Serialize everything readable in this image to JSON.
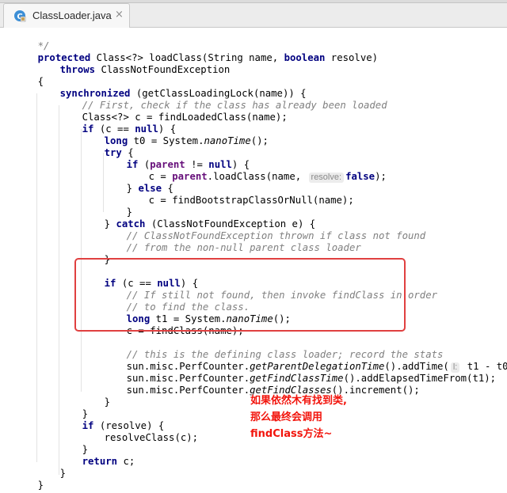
{
  "tab": {
    "file_name": "ClassLoader.java",
    "close_symbol": "×",
    "icon": "java-class-icon"
  },
  "code": {
    "line_01": "*/",
    "line_02": {
      "k1": "protected",
      "t1": " Class<?> loadClass(String name, ",
      "k2": "boolean",
      "t2": " resolve)"
    },
    "line_03": {
      "k1": "throws",
      "t1": " ClassNotFoundException"
    },
    "line_04": "{",
    "line_05": {
      "k1": "synchronized",
      "t1": " (getClassLoadingLock(name)) {"
    },
    "line_06": "// First, check if the class has already been loaded",
    "line_07": "Class<?> c = findLoadedClass(name);",
    "line_08": {
      "k1": "if",
      "t1": " (c == ",
      "k2": "null",
      "t2": ") {"
    },
    "line_09": {
      "k1": "long",
      "t1": " t0 = System.",
      "i1": "nanoTime",
      "t2": "();"
    },
    "line_10": {
      "k1": "try",
      "t1": " {"
    },
    "line_11": {
      "k1": "if",
      "t1": " (",
      "f1": "parent",
      "t2": " != ",
      "k2": "null",
      "t3": ") {"
    },
    "line_12": {
      "t1": "c = ",
      "f1": "parent",
      "t2": ".loadClass(name, ",
      "hint": "resolve:",
      "k1": "false",
      "t3": ");"
    },
    "line_13": {
      "t1": "} ",
      "k1": "else",
      "t2": " {"
    },
    "line_14": "c = findBootstrapClassOrNull(name);",
    "line_15": "}",
    "line_16": {
      "t1": "} ",
      "k1": "catch",
      "t2": " (ClassNotFoundException e) {"
    },
    "line_17": "// ClassNotFoundException thrown if class not found",
    "line_18": "// from the non-null parent class loader",
    "line_19": "}",
    "line_20": {
      "k1": "if",
      "t1": " (c == ",
      "k2": "null",
      "t2": ") {"
    },
    "line_21": "// If still not found, then invoke findClass in order",
    "line_22": "// to find the class.",
    "line_23": {
      "k1": "long",
      "t1": " t1 = System.",
      "i1": "nanoTime",
      "t2": "();"
    },
    "line_24": "c = findClass(name);",
    "line_25": "// this is the defining class loader; record the stats",
    "line_26": {
      "t1": "sun.misc.PerfCounter.",
      "i1": "getParentDelegationTime",
      "t2": "().addTime(",
      "hint": "l:",
      "t3": " t1 - t0);"
    },
    "line_27": {
      "t1": "sun.misc.PerfCounter.",
      "i1": "getFindClassTime",
      "t2": "().addElapsedTimeFrom(t1);"
    },
    "line_28": {
      "t1": "sun.misc.PerfCounter.",
      "i1": "getFindClasses",
      "t2": "().increment();"
    },
    "line_29": "}",
    "line_30": "}",
    "line_31": {
      "k1": "if",
      "t1": " (resolve) {"
    },
    "line_32": "resolveClass(c);",
    "line_33": "}",
    "line_34": {
      "k1": "return",
      "t1": " c;"
    },
    "line_35": "}",
    "line_36": "}"
  },
  "annotation": {
    "line1": "如果依然木有找到类,",
    "line2": "那么最终会调用",
    "line3": "findClass方法~",
    "color": "#f2140c"
  },
  "colors": {
    "keyword": "#000080",
    "comment": "#808080",
    "field": "#660e7a",
    "highlight_border": "#e04040"
  }
}
